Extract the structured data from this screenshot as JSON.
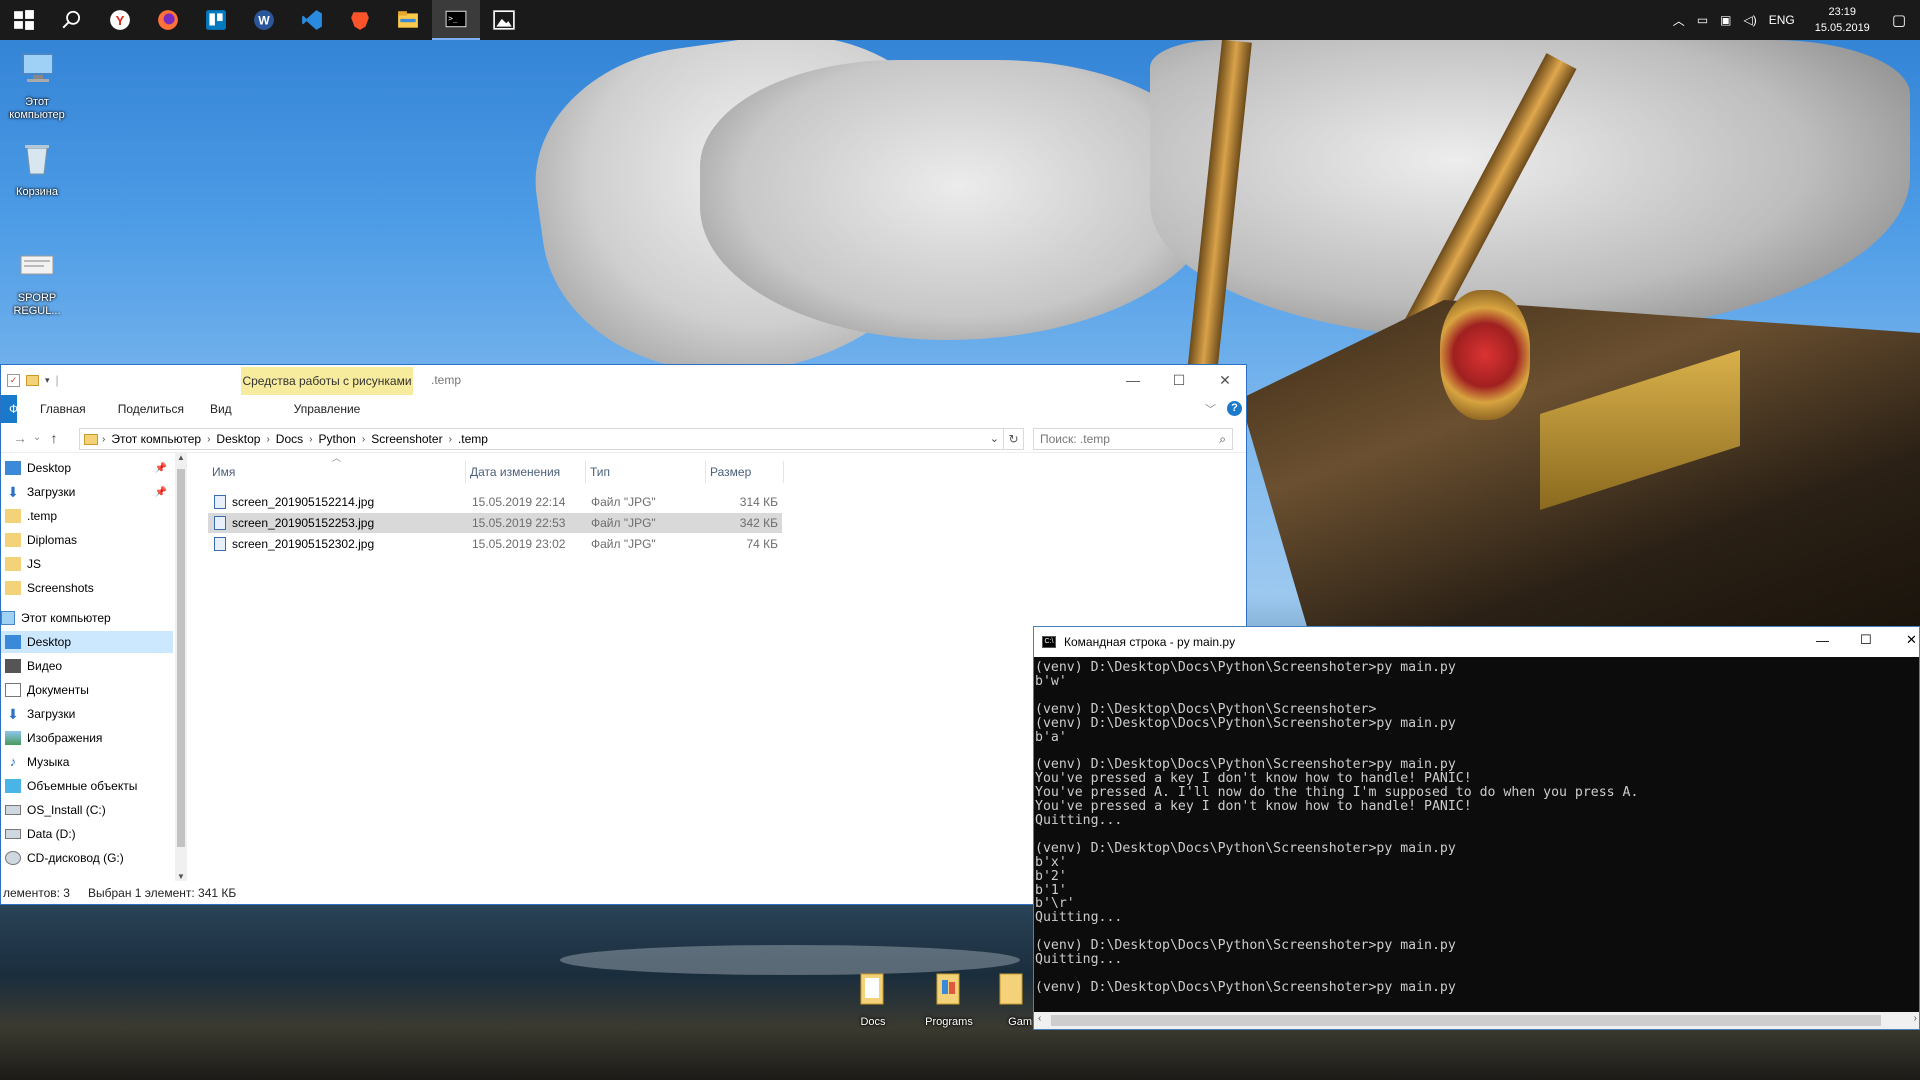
{
  "taskbar": {
    "apps": [
      {
        "name": "start-icon"
      },
      {
        "name": "search-icon"
      },
      {
        "name": "yandex-browser-icon"
      },
      {
        "name": "firefox-icon"
      },
      {
        "name": "trello-icon"
      },
      {
        "name": "word-icon"
      },
      {
        "name": "vscode-icon"
      },
      {
        "name": "brave-icon"
      },
      {
        "name": "file-explorer-icon"
      },
      {
        "name": "cmd-icon"
      },
      {
        "name": "photos-icon"
      }
    ],
    "tray": {
      "lang": "ENG",
      "time": "23:19",
      "date": "15.05.2019"
    }
  },
  "desktop": {
    "icons": [
      {
        "label": "Этот компьютер"
      },
      {
        "label": "Корзина"
      },
      {
        "label": "SPORP REGUL..."
      }
    ],
    "bottom_icons": [
      {
        "label": "Docs"
      },
      {
        "label": "Programs"
      },
      {
        "label": "Gam"
      }
    ]
  },
  "explorer": {
    "context_tab": "Средства работы с рисунками",
    "title": ".temp",
    "ribbon_tabs": [
      "Файл",
      "Главная",
      "Поделиться",
      "Вид"
    ],
    "manage_tab": "Управление",
    "breadcrumb": [
      "Этот компьютер",
      "Desktop",
      "Docs",
      "Python",
      "Screenshoter",
      ".temp"
    ],
    "search_placeholder": "Поиск: .temp",
    "nav_items": [
      {
        "label": "Desktop",
        "pinned": true
      },
      {
        "label": "Загрузки",
        "pinned": true
      },
      {
        "label": ".temp"
      },
      {
        "label": "Diplomas"
      },
      {
        "label": "JS"
      },
      {
        "label": "Screenshots"
      },
      {
        "label": "Этот компьютер"
      },
      {
        "label": "Desktop",
        "selected": true
      },
      {
        "label": "Видео"
      },
      {
        "label": "Документы"
      },
      {
        "label": "Загрузки"
      },
      {
        "label": "Изображения"
      },
      {
        "label": "Музыка"
      },
      {
        "label": "Объемные объекты"
      },
      {
        "label": "OS_Install (C:)"
      },
      {
        "label": "Data (D:)"
      },
      {
        "label": "CD-дисковод (G:)"
      }
    ],
    "columns": [
      "Имя",
      "Дата изменения",
      "Тип",
      "Размер"
    ],
    "files": [
      {
        "name": "screen_201905152214.jpg",
        "date": "15.05.2019 22:14",
        "type": "Файл \"JPG\"",
        "size": "314 КБ"
      },
      {
        "name": "screen_201905152253.jpg",
        "date": "15.05.2019 22:53",
        "type": "Файл \"JPG\"",
        "size": "342 КБ",
        "selected": true
      },
      {
        "name": "screen_201905152302.jpg",
        "date": "15.05.2019 23:02",
        "type": "Файл \"JPG\"",
        "size": "74 КБ"
      }
    ],
    "status_count": "лементов: 3",
    "status_selected": "Выбран 1 элемент: 341 КБ"
  },
  "cmd": {
    "title": "Командная строка - py  main.py",
    "lines": [
      "(venv) D:\\Desktop\\Docs\\Python\\Screenshoter>py main.py",
      "b'w'",
      "",
      "(venv) D:\\Desktop\\Docs\\Python\\Screenshoter>",
      "(venv) D:\\Desktop\\Docs\\Python\\Screenshoter>py main.py",
      "b'a'",
      "",
      "(venv) D:\\Desktop\\Docs\\Python\\Screenshoter>py main.py",
      "You've pressed a key I don't know how to handle! PANIC!",
      "You've pressed A. I'll now do the thing I'm supposed to do when you press A.",
      "You've pressed a key I don't know how to handle! PANIC!",
      "Quitting...",
      "",
      "(venv) D:\\Desktop\\Docs\\Python\\Screenshoter>py main.py",
      "b'x'",
      "b'2'",
      "b'1'",
      "b'\\r'",
      "Quitting...",
      "",
      "(venv) D:\\Desktop\\Docs\\Python\\Screenshoter>py main.py",
      "Quitting...",
      "",
      "(venv) D:\\Desktop\\Docs\\Python\\Screenshoter>py main.py",
      "_"
    ]
  }
}
